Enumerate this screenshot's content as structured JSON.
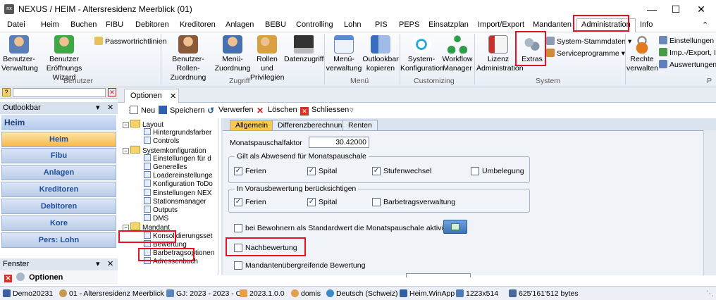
{
  "window": {
    "title": "NEXUS / HEIM - Altersresidenz Meerblick (01)",
    "app_icon": "nx"
  },
  "menu": [
    "Datei",
    "Heim",
    "Buchen",
    "FIBU",
    "Debitoren",
    "Kreditoren",
    "Anlagen",
    "BEBU",
    "Controlling",
    "Lohn",
    "PIS",
    "PEPS",
    "Einsatzplan",
    "Import/Export",
    "Mandanten",
    "Administration",
    "Info"
  ],
  "ribbon": {
    "benutzer": {
      "label": "Benutzer",
      "btn1": [
        "Benutzer-",
        "Verwaltung"
      ],
      "btn2": [
        "Benutzer",
        "Eröffnungs Wizard"
      ],
      "small": "Passwortrichtlinien"
    },
    "zugriff": {
      "label": "Zugriff",
      "btn1": [
        "Benutzer-Rollen-",
        "Zuordnung"
      ],
      "btn2": [
        "Menü-",
        "Zuordnung"
      ],
      "btn3": [
        "Rollen und",
        "Privilegien"
      ],
      "btn4": [
        "Datenzugriff",
        ""
      ]
    },
    "menu_grp": {
      "label": "Menü",
      "btn1": [
        "Menü-",
        "verwaltung"
      ],
      "btn2": [
        "Outlookbar",
        "kopieren"
      ]
    },
    "customizing": {
      "label": "Customizing",
      "btn1": [
        "System-",
        "Konfiguration"
      ],
      "btn2": [
        "Workflow",
        "Manager"
      ]
    },
    "system": {
      "label": "System",
      "btn1": [
        "Lizenz",
        "Administration"
      ],
      "btn2": [
        "Extras",
        ""
      ],
      "small1": "System-Stammdaten",
      "small2": "Serviceprogramme"
    },
    "rechte": {
      "btn1": [
        "Rechte",
        "verwalten"
      ],
      "small1": "Einstellungen",
      "small2": "Imp.-/Export, I",
      "small3": "Auswertungen"
    }
  },
  "outlookbar": {
    "title": "Outlookbar",
    "header": "Heim",
    "items": [
      "Heim",
      "Fibu",
      "Anlagen",
      "Kreditoren",
      "Debitoren",
      "Kore",
      "Pers: Lohn"
    ]
  },
  "fenster": {
    "title": "Fenster",
    "item": "Optionen"
  },
  "doc_tab": "Optionen",
  "toolbar": {
    "neu": "Neu",
    "speichern": "Speichern",
    "verwerfen": "Verwerfen",
    "loeschen": "Löschen",
    "schliessen": "Schliessen"
  },
  "tree": [
    {
      "label": "Layout",
      "type": "folder",
      "level": 0
    },
    {
      "label": "Hintergrundsfarber",
      "type": "leaf",
      "level": 1
    },
    {
      "label": "Controls",
      "type": "leaf",
      "level": 1
    },
    {
      "label": "Systemkonfiguration",
      "type": "folder",
      "level": 0
    },
    {
      "label": "Einstellungen für d",
      "type": "leaf",
      "level": 1
    },
    {
      "label": "Generelles",
      "type": "leaf",
      "level": 1
    },
    {
      "label": "Loadereinstellunge",
      "type": "leaf",
      "level": 1
    },
    {
      "label": "Konfiguration ToDo",
      "type": "leaf",
      "level": 1
    },
    {
      "label": "Einstellungen NEX",
      "type": "leaf",
      "level": 1
    },
    {
      "label": "Stationsmanager",
      "type": "leaf",
      "level": 1
    },
    {
      "label": "Outputs",
      "type": "leaf",
      "level": 1
    },
    {
      "label": "DMS",
      "type": "leaf",
      "level": 1
    },
    {
      "label": "Mandant",
      "type": "folder",
      "level": 0
    },
    {
      "label": "Konsolidierungsset",
      "type": "leaf",
      "level": 1
    },
    {
      "label": "Bewertung",
      "type": "leaf",
      "level": 1
    },
    {
      "label": "Barbetragsoptionen",
      "type": "leaf",
      "level": 1
    },
    {
      "label": "Adressenbuch",
      "type": "leaf",
      "level": 1
    }
  ],
  "options": {
    "tabs": [
      "Allgemein",
      "Differenzberechnung",
      "Renten"
    ],
    "monatspauschalfaktor_label": "Monatspauschalfaktor",
    "monatspauschalfaktor_value": "30.42000",
    "group1": {
      "title": "Gilt als Abwesend für Monatspauschale",
      "items": [
        {
          "label": "Ferien",
          "checked": true
        },
        {
          "label": "Spital",
          "checked": true
        },
        {
          "label": "Stufenwechsel",
          "checked": true
        },
        {
          "label": "Umbelegung",
          "checked": false
        }
      ]
    },
    "group2": {
      "title": "In Vorausbewertung berücksichtigen",
      "items": [
        {
          "label": "Ferien",
          "checked": true
        },
        {
          "label": "Spital",
          "checked": true
        },
        {
          "label": "Barbetragsverwaltung",
          "checked": false
        }
      ]
    },
    "bewohner_label": "bei Bewohnern als Standardwert die Monatspauschale aktivieren",
    "nachbewertung_label": "Nachbewertung",
    "mandanten_label": "Mandantenübergreifende Bewertung"
  },
  "status": [
    "Demo20231",
    "01 - Altersresidenz Meerblick",
    "GJ: 2023 - 2023 - O",
    "2023.1.0.0",
    "domis",
    "Deutsch (Schweiz)",
    "Heim.WinApp",
    "1223x514",
    "625'161'512 bytes"
  ]
}
